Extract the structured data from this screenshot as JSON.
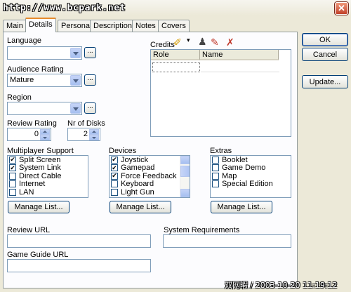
{
  "watermark": "http://www.bcpark.net",
  "window": {
    "close_glyph": "✕"
  },
  "tabs": [
    "Main",
    "Details",
    "Personal",
    "Description",
    "Notes",
    "Covers"
  ],
  "active_tab": "Details",
  "language": {
    "label": "Language",
    "value": ""
  },
  "audience_rating": {
    "label": "Audience Rating",
    "value": "Mature"
  },
  "region": {
    "label": "Region",
    "value": ""
  },
  "review_rating": {
    "label": "Review Rating",
    "value": "0"
  },
  "nr_disks": {
    "label": "Nr of Disks",
    "value": "2"
  },
  "browse_label": "...",
  "credits": {
    "label": "Credits",
    "columns": [
      "Role",
      "Name"
    ],
    "toolbar_icons": [
      "add-credit-icon",
      "dropdown-arrow-icon",
      "people-icon",
      "edit-icon",
      "delete-icon"
    ]
  },
  "multiplayer": {
    "label": "Multiplayer Support",
    "items": [
      {
        "label": "Split Screen",
        "checked": true
      },
      {
        "label": "System Link",
        "checked": true
      },
      {
        "label": "Direct Cable",
        "checked": false
      },
      {
        "label": "Internet",
        "checked": false
      },
      {
        "label": "LAN",
        "checked": false
      }
    ]
  },
  "devices": {
    "label": "Devices",
    "items": [
      {
        "label": "Joystick",
        "checked": true
      },
      {
        "label": "Gamepad",
        "checked": true
      },
      {
        "label": "Force Feedback",
        "checked": true
      },
      {
        "label": "Keyboard",
        "checked": false
      },
      {
        "label": "Light Gun",
        "checked": false
      }
    ]
  },
  "extras": {
    "label": "Extras",
    "items": [
      {
        "label": "Booklet",
        "checked": false
      },
      {
        "label": "Game Demo",
        "checked": false
      },
      {
        "label": "Map",
        "checked": false
      },
      {
        "label": "Special Edition",
        "checked": false
      }
    ]
  },
  "manage_list_label": "Manage List...",
  "review_url": {
    "label": "Review URL",
    "value": ""
  },
  "system_requirements": {
    "label": "System Requirements",
    "value": ""
  },
  "game_guide_url": {
    "label": "Game Guide URL",
    "value": ""
  },
  "buttons": {
    "ok": "OK",
    "cancel": "Cancel",
    "update": "Update..."
  },
  "status_watermark": "双网暇 / 2003-10-20 11:19:12"
}
